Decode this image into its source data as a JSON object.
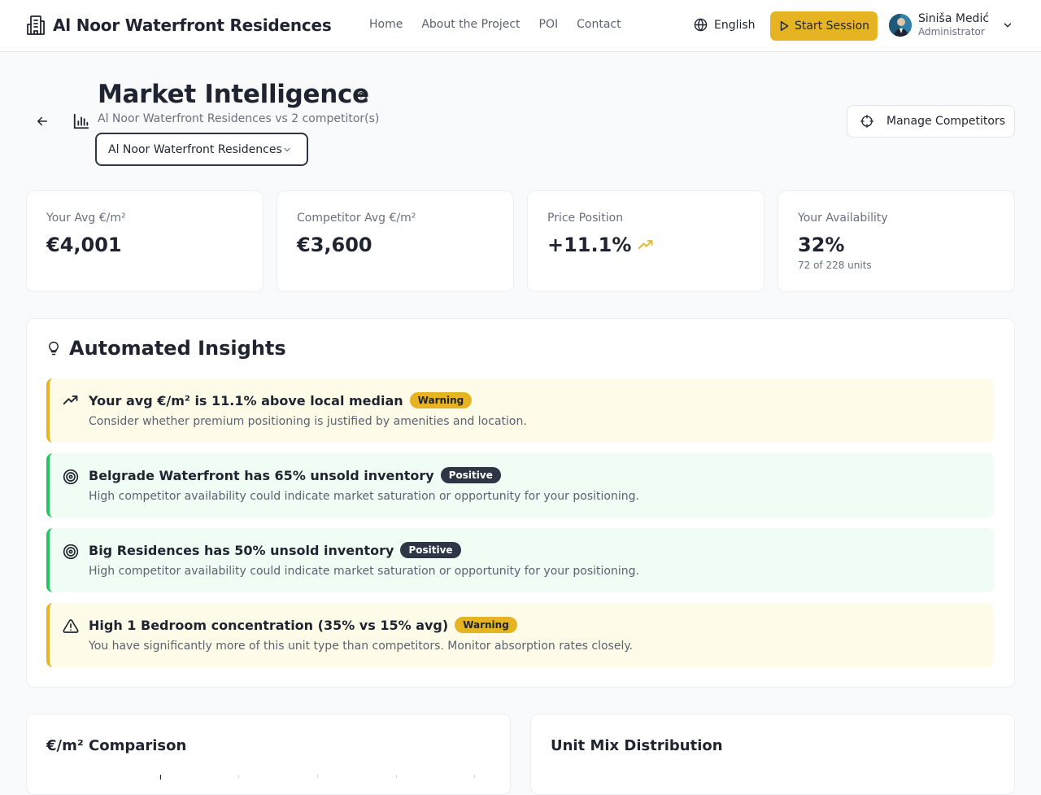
{
  "app": {
    "brand": "Al Noor Waterfront Residences",
    "nav": [
      "Home",
      "About the Project",
      "POI",
      "Contact"
    ],
    "language": "English",
    "start_session": "Start Session",
    "user": {
      "name": "Siniša Medić",
      "role": "Administrator"
    }
  },
  "header": {
    "title": "Market Intelligence",
    "subtitle": "Al Noor Waterfront Residences vs 2 competitor(s)",
    "project_select": "Al Noor Waterfront Residences",
    "manage_competitors": "Manage Competitors"
  },
  "stats": [
    {
      "label": "Your Avg €/m²",
      "value": "€4,001"
    },
    {
      "label": "Competitor Avg €/m²",
      "value": "€3,600"
    },
    {
      "label": "Price Position",
      "value": "+11.1%"
    },
    {
      "label": "Your Availability",
      "value": "32%",
      "sub": "72 of 228 units"
    }
  ],
  "insights": {
    "title": "Automated Insights",
    "items": [
      {
        "type": "warning",
        "icon": "trending-up-icon",
        "title": "Your avg €/m² is 11.1% above local median",
        "badge": "Warning",
        "desc": "Consider whether premium positioning is justified by amenities and location."
      },
      {
        "type": "positive",
        "icon": "target-icon",
        "title": "Belgrade Waterfront has 65% unsold inventory",
        "badge": "Positive",
        "desc": "High competitor availability could indicate market saturation or opportunity for your positioning."
      },
      {
        "type": "positive",
        "icon": "target-icon",
        "title": "Big Residences has 50% unsold inventory",
        "badge": "Positive",
        "desc": "High competitor availability could indicate market saturation or opportunity for your positioning."
      },
      {
        "type": "warning",
        "icon": "alert-triangle-icon",
        "title": "High 1 Bedroom concentration (35% vs 15% avg)",
        "badge": "Warning",
        "desc": "You have significantly more of this unit type than competitors. Monitor absorption rates closely."
      }
    ]
  },
  "panels": {
    "comparison_title": "€/m² Comparison",
    "unit_mix_title": "Unit Mix Distribution"
  },
  "colors": {
    "accent": "#e6b422",
    "warning_bg": "#fefce8",
    "positive_bg": "#f0fdf4",
    "positive_border": "#22c55e",
    "badge_dark": "#2e3646"
  }
}
